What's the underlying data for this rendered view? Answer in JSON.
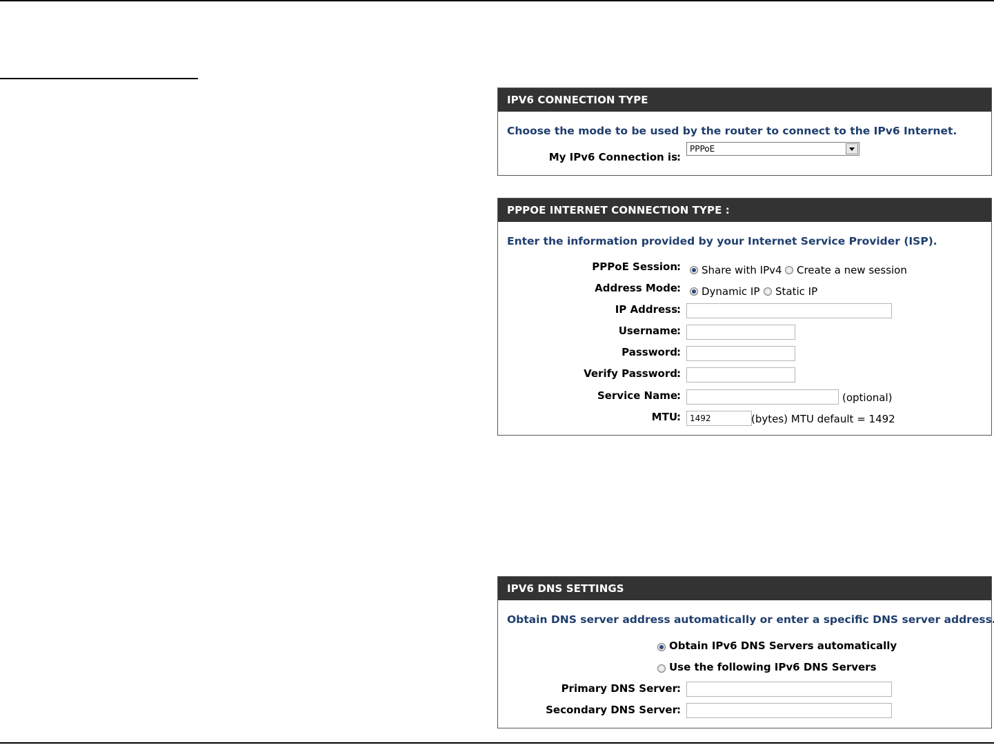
{
  "connection_panel": {
    "header": "IPV6 CONNECTION TYPE",
    "intro": "Choose the mode to be used by the router to connect to the IPv6 Internet.",
    "connection_label": "My IPv6 Connection is",
    "connection_value": "PPPoE"
  },
  "pppoe_panel": {
    "header": "PPPOE INTERNET CONNECTION TYPE :",
    "intro": "Enter the information provided by your Internet Service Provider (ISP).",
    "session_label": "PPPoE Session",
    "session_options": [
      "Share with IPv4",
      "Create a new session"
    ],
    "session_selected": "Share with IPv4",
    "address_mode_label": "Address Mode",
    "address_mode_options": [
      "Dynamic IP",
      "Static IP"
    ],
    "address_mode_selected": "Dynamic IP",
    "ip_address_label": "IP Address",
    "ip_address_value": "",
    "username_label": "Username",
    "username_value": "",
    "password_label": "Password",
    "password_value": "",
    "verify_password_label": "Verify Password",
    "verify_password_value": "",
    "service_name_label": "Service Name",
    "service_name_value": "",
    "service_name_note": "(optional)",
    "mtu_label": "MTU",
    "mtu_value": "1492",
    "mtu_note": "(bytes) MTU default = 1492"
  },
  "dns_panel": {
    "header": "IPV6 DNS SETTINGS",
    "intro": "Obtain DNS server address automatically or enter a specific DNS server address.",
    "auto_option": "Obtain IPv6 DNS Servers automatically",
    "manual_option": "Use the following IPv6 DNS Servers",
    "selected": "auto",
    "primary_label": "Primary DNS Server",
    "primary_value": "",
    "secondary_label": "Secondary DNS Server",
    "secondary_value": ""
  },
  "colon": ":"
}
